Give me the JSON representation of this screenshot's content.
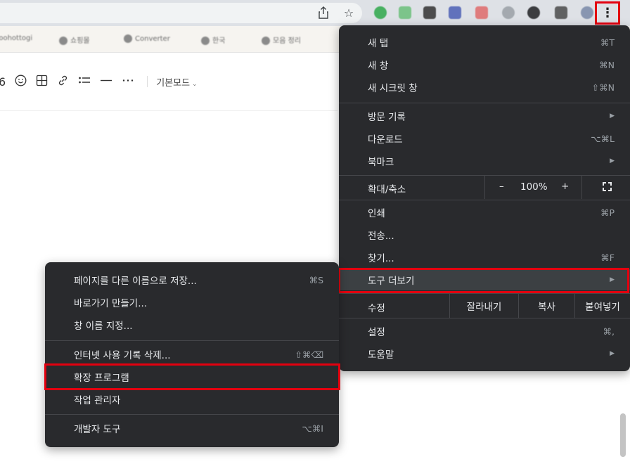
{
  "browser": {
    "share_icon": "share-icon",
    "bookmark_star_icon": "star-icon",
    "kebab_glyph": "⋮",
    "extensions": [
      {
        "icon": "extension-icon",
        "color": "#2ea84a"
      },
      {
        "icon": "extension-icon",
        "color": "#6bbf7a"
      },
      {
        "icon": "extension-icon",
        "color": "#333333"
      },
      {
        "icon": "extension-icon",
        "color": "#4c5fb5"
      },
      {
        "icon": "extension-icon",
        "color": "#e06b6b"
      },
      {
        "icon": "extension-icon",
        "color": "#9aa0a6"
      },
      {
        "icon": "extension-icon",
        "color": "#202124"
      },
      {
        "icon": "extension-icon",
        "color": "#4b4b4b"
      },
      {
        "icon": "extension-icon",
        "color": "#7a8aa8"
      }
    ]
  },
  "bookmarks": [
    {
      "label": "hoohottogi"
    },
    {
      "label": "쇼핑몰"
    },
    {
      "label": "Converter"
    },
    {
      "label": "한국"
    },
    {
      "label": "모음 정리"
    }
  ],
  "editor": {
    "partial_number": "6",
    "mode_label": "기본모드",
    "toolbar_icons": [
      "emoji-icon",
      "table-icon",
      "link-icon",
      "list-icon",
      "divider-icon",
      "more-icon"
    ]
  },
  "chrome_menu": {
    "new_tab": {
      "label": "새 탭",
      "shortcut": "⌘T"
    },
    "new_window": {
      "label": "새 창",
      "shortcut": "⌘N"
    },
    "incognito": {
      "label": "새 시크릿 창",
      "shortcut": "⇧⌘N"
    },
    "history": {
      "label": "방문 기록"
    },
    "downloads": {
      "label": "다운로드",
      "shortcut": "⌥⌘L"
    },
    "bookmarks": {
      "label": "북마크"
    },
    "zoom": {
      "label": "확대/축소",
      "minus": "–",
      "value": "100%",
      "plus": "+"
    },
    "print": {
      "label": "인쇄",
      "shortcut": "⌘P"
    },
    "cast": {
      "label": "전송..."
    },
    "find": {
      "label": "찾기...",
      "shortcut": "⌘F"
    },
    "more_tools": {
      "label": "도구 더보기"
    },
    "edit": {
      "label": "수정",
      "cut": "잘라내기",
      "copy": "복사",
      "paste": "붙여넣기"
    },
    "settings": {
      "label": "설정",
      "shortcut": "⌘,"
    },
    "help": {
      "label": "도움말"
    }
  },
  "tools_submenu": {
    "save_page": {
      "label": "페이지를 다른 이름으로 저장...",
      "shortcut": "⌘S"
    },
    "create_shortcut": {
      "label": "바로가기 만들기..."
    },
    "name_window": {
      "label": "창 이름 지정..."
    },
    "clear_data": {
      "label": "인터넷 사용 기록 삭제...",
      "shortcut": "⇧⌘⌫"
    },
    "extensions": {
      "label": "확장 프로그램"
    },
    "task_manager": {
      "label": "작업 관리자"
    },
    "dev_tools": {
      "label": "개발자 도구",
      "shortcut": "⌥⌘I"
    }
  },
  "highlight_color": "#e3000f"
}
